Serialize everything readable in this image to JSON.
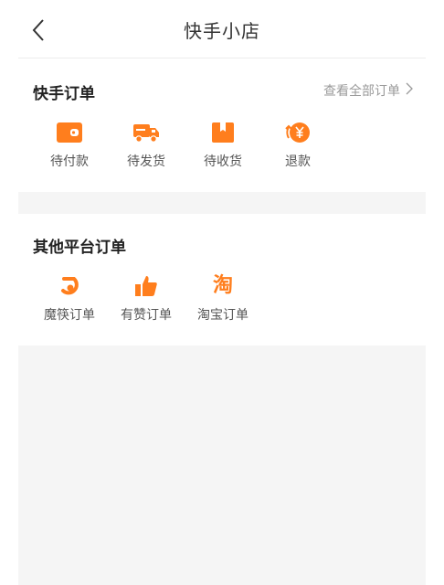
{
  "header": {
    "title": "快手小店"
  },
  "kuaishou_orders": {
    "title": "快手订单",
    "view_all": "查看全部订单",
    "items": [
      {
        "label": "待付款",
        "icon": "wallet-icon"
      },
      {
        "label": "待发货",
        "icon": "delivery-truck-icon"
      },
      {
        "label": "待收货",
        "icon": "package-box-icon"
      },
      {
        "label": "退款",
        "icon": "refund-yen-icon"
      }
    ]
  },
  "other_orders": {
    "title": "其他平台订单",
    "items": [
      {
        "label": "魔筷订单",
        "icon": "mokuai-logo-icon"
      },
      {
        "label": "有赞订单",
        "icon": "thumbs-up-icon"
      },
      {
        "label": "淘宝订单",
        "icon": "taobao-logo-icon"
      }
    ],
    "taobao_icon_glyph": "淘"
  },
  "colors": {
    "accent": "#FF7E1D",
    "background_gray": "#F5F5F5",
    "muted_text": "#9A9A9A"
  }
}
